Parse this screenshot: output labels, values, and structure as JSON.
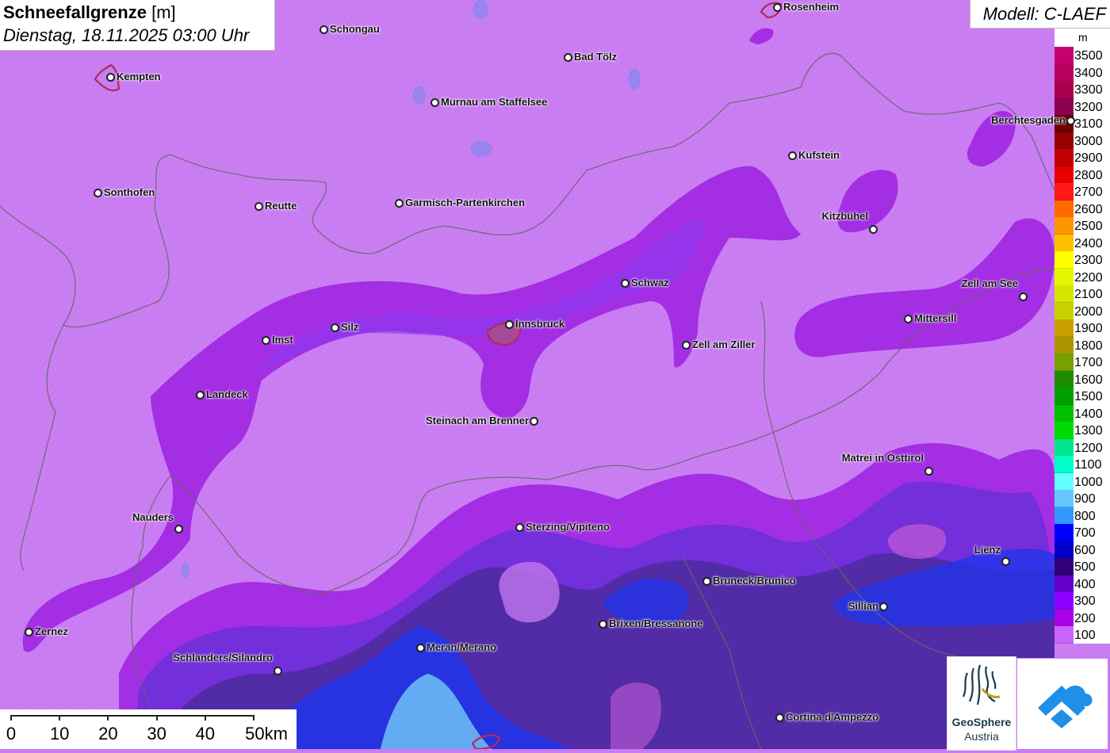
{
  "title": {
    "main": "Schneefallgrenze",
    "unit": "[m]",
    "datetime": "Dienstag, 18.11.2025 03:00 Uhr"
  },
  "model": "Modell: C-LAEF",
  "legend": {
    "unit": "m",
    "entries": [
      {
        "label": "3500",
        "color": "#c8006e"
      },
      {
        "label": "3400",
        "color": "#b8005f"
      },
      {
        "label": "3300",
        "color": "#a8004f"
      },
      {
        "label": "3200",
        "color": "#8c0050"
      },
      {
        "label": "3100",
        "color": "#6e0000"
      },
      {
        "label": "3000",
        "color": "#960000"
      },
      {
        "label": "2900",
        "color": "#c00000"
      },
      {
        "label": "2800",
        "color": "#e60000"
      },
      {
        "label": "2700",
        "color": "#ff1a1a"
      },
      {
        "label": "2600",
        "color": "#ff6a00"
      },
      {
        "label": "2500",
        "color": "#ff9600"
      },
      {
        "label": "2400",
        "color": "#ffbe00"
      },
      {
        "label": "2300",
        "color": "#ffff00"
      },
      {
        "label": "2200",
        "color": "#e6f500"
      },
      {
        "label": "2100",
        "color": "#d2e600"
      },
      {
        "label": "2000",
        "color": "#c8d200"
      },
      {
        "label": "1900",
        "color": "#c8a000"
      },
      {
        "label": "1800",
        "color": "#aa9600"
      },
      {
        "label": "1700",
        "color": "#78a000"
      },
      {
        "label": "1600",
        "color": "#1e8c00"
      },
      {
        "label": "1500",
        "color": "#00a000"
      },
      {
        "label": "1400",
        "color": "#00be00"
      },
      {
        "label": "1300",
        "color": "#00dc00"
      },
      {
        "label": "1200",
        "color": "#00e68c"
      },
      {
        "label": "1100",
        "color": "#00ffc8"
      },
      {
        "label": "1000",
        "color": "#64ffff"
      },
      {
        "label": "900",
        "color": "#64c8ff"
      },
      {
        "label": "800",
        "color": "#3296ff"
      },
      {
        "label": "700",
        "color": "#0000ff"
      },
      {
        "label": "600",
        "color": "#0000c8"
      },
      {
        "label": "500",
        "color": "#300078"
      },
      {
        "label": "400",
        "color": "#6400c8"
      },
      {
        "label": "300",
        "color": "#8c00ff"
      },
      {
        "label": "200",
        "color": "#aa00e6"
      },
      {
        "label": "100",
        "color": "#c864ff"
      }
    ]
  },
  "cities": [
    {
      "name": "Rosenheim",
      "side": "right"
    },
    {
      "name": "Schongau",
      "side": "right"
    },
    {
      "name": "Bad Tölz",
      "side": "right"
    },
    {
      "name": "Kempten",
      "side": "right"
    },
    {
      "name": "Murnau am Staffelsee",
      "side": "right"
    },
    {
      "name": "Berchtesgaden",
      "side": "left"
    },
    {
      "name": "Kufstein",
      "side": "right"
    },
    {
      "name": "Sonthofen",
      "side": "right"
    },
    {
      "name": "Reutte",
      "side": "right"
    },
    {
      "name": "Garmisch-Partenkirchen",
      "side": "right"
    },
    {
      "name": "Kitzbühel",
      "side": "left"
    },
    {
      "name": "Schwaz",
      "side": "right"
    },
    {
      "name": "Zell am See",
      "side": "left"
    },
    {
      "name": "Mittersill",
      "side": "right"
    },
    {
      "name": "Imst",
      "side": "right"
    },
    {
      "name": "Silz",
      "side": "right"
    },
    {
      "name": "Innsbruck",
      "side": "right"
    },
    {
      "name": "Zell am Ziller",
      "side": "right"
    },
    {
      "name": "Landeck",
      "side": "right"
    },
    {
      "name": "Steinach am Brenner",
      "side": "left"
    },
    {
      "name": "Matrei in Osttirol",
      "side": "left"
    },
    {
      "name": "Nauders",
      "side": "left"
    },
    {
      "name": "Sterzing/Vipiteno",
      "side": "right"
    },
    {
      "name": "Lienz",
      "side": "left"
    },
    {
      "name": "Bruneck/Brunico",
      "side": "right"
    },
    {
      "name": "Sillian",
      "side": "left"
    },
    {
      "name": "Brixen/Bressanone",
      "side": "right"
    },
    {
      "name": "Zernez",
      "side": "right"
    },
    {
      "name": "Meran/Merano",
      "side": "right"
    },
    {
      "name": "Schlanders/Silandro",
      "side": "left"
    },
    {
      "name": "Cortina d'Ampezzo",
      "side": "right"
    }
  ],
  "scale": {
    "labels": [
      "0",
      "10",
      "20",
      "30",
      "40",
      "50km"
    ]
  },
  "logos": {
    "geosphere_name": "GeoSphere",
    "geosphere_sub": "Austria"
  }
}
